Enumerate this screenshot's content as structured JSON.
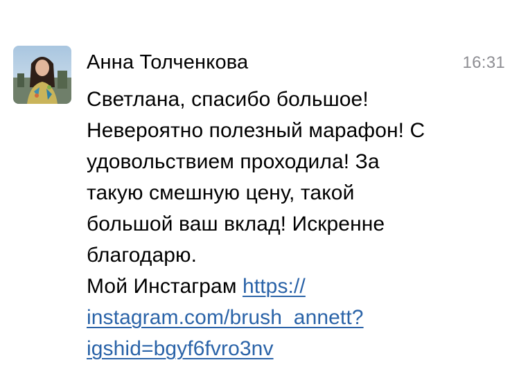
{
  "message": {
    "sender_name": "Анна Толченкова",
    "time": "16:31",
    "lines": [
      "Светлана, спасибо большое!",
      "Невероятно полезный марафон! С",
      "удовольствием проходила! За",
      "такую смешную цену, такой",
      "большой ваш вклад! Искренне",
      "благодарю."
    ],
    "link_prefix": "Мой Инстаграм",
    "link_lines": [
      "https://",
      "instagram.com/brush_annett?",
      "igshid=bgyf6fvro3nv"
    ],
    "link_url": "https://instagram.com/brush_annett?igshid=bgyf6fvro3nv",
    "link_color": "#2a63a8",
    "time_color": "#8e8e93"
  },
  "avatar": {
    "icon": "user-photo-avatar"
  }
}
